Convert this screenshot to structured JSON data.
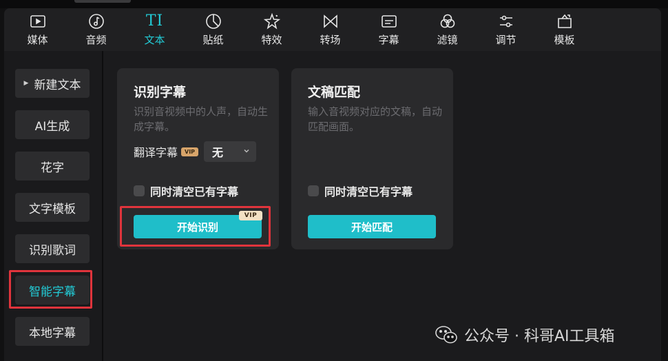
{
  "toolbar": {
    "tabs": [
      {
        "label": "媒体",
        "icon": "media-play-icon"
      },
      {
        "label": "音频",
        "icon": "audio-note-icon"
      },
      {
        "label": "文本",
        "icon": "text-ti-icon",
        "glyph": "TI",
        "active": true
      },
      {
        "label": "贴纸",
        "icon": "sticker-icon"
      },
      {
        "label": "特效",
        "icon": "effects-star-icon"
      },
      {
        "label": "转场",
        "icon": "transition-bowtie-icon"
      },
      {
        "label": "字幕",
        "icon": "caption-icon"
      },
      {
        "label": "滤镜",
        "icon": "filter-circles-icon"
      },
      {
        "label": "调节",
        "icon": "adjust-sliders-icon"
      },
      {
        "label": "模板",
        "icon": "template-icon"
      }
    ]
  },
  "sidebar": {
    "items": [
      {
        "label": "新建文本",
        "has_arrow": true
      },
      {
        "label": "AI生成"
      },
      {
        "label": "花字"
      },
      {
        "label": "文字模板"
      },
      {
        "label": "识别歌词"
      },
      {
        "label": "智能字幕",
        "active": true
      },
      {
        "label": "本地字幕"
      }
    ]
  },
  "cards": {
    "recognize": {
      "title": "识别字幕",
      "desc": "识别音视频中的人声，自动生成字幕。",
      "translate_label": "翻译字幕",
      "translate_badge": "VIP",
      "translate_value": "无",
      "checkbox_label": "同时清空已有字幕",
      "button_label": "开始识别",
      "button_badge": "VIP"
    },
    "match": {
      "title": "文稿匹配",
      "desc": "输入音视频对应的文稿，自动匹配画面。",
      "checkbox_label": "同时清空已有字幕",
      "button_label": "开始匹配"
    }
  },
  "watermark": {
    "text": "公众号 · 科哥AI工具箱",
    "icon": "wechat-icon"
  },
  "colors": {
    "accent": "#22cbd6",
    "button": "#1fbec9",
    "highlight_box": "#e0343c",
    "vip_gold": "#d7a46a"
  }
}
